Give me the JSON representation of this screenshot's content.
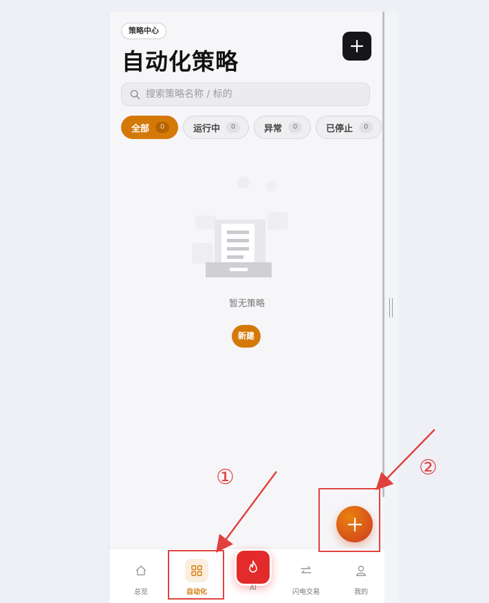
{
  "header": {
    "badge": "策略中心",
    "title": "自动化策略"
  },
  "search": {
    "placeholder": "搜索策略名称 / 标的"
  },
  "tabs": [
    {
      "label": "全部",
      "count": "0",
      "active": true
    },
    {
      "label": "运行中",
      "count": "0",
      "active": false
    },
    {
      "label": "异常",
      "count": "0",
      "active": false
    },
    {
      "label": "已停止",
      "count": "0",
      "active": false
    }
  ],
  "empty_state": {
    "text": "暂无策略",
    "button": "新建"
  },
  "bottom_nav": {
    "items": [
      {
        "label": "总览",
        "icon": "home-icon"
      },
      {
        "label": "自动化",
        "icon": "grid-icon"
      },
      {
        "label": "AI",
        "icon": "flame-icon"
      },
      {
        "label": "闪电交易",
        "icon": "transfer-arrows-icon"
      },
      {
        "label": "我的",
        "icon": "user-icon"
      }
    ]
  },
  "annotations": {
    "marker_1": "①",
    "marker_2": "②"
  },
  "colors": {
    "accent": "#d47808",
    "fab": "#d9561a",
    "ai": "#e32b2b",
    "annotation": "#e0413e",
    "top_button": "#15151a"
  }
}
